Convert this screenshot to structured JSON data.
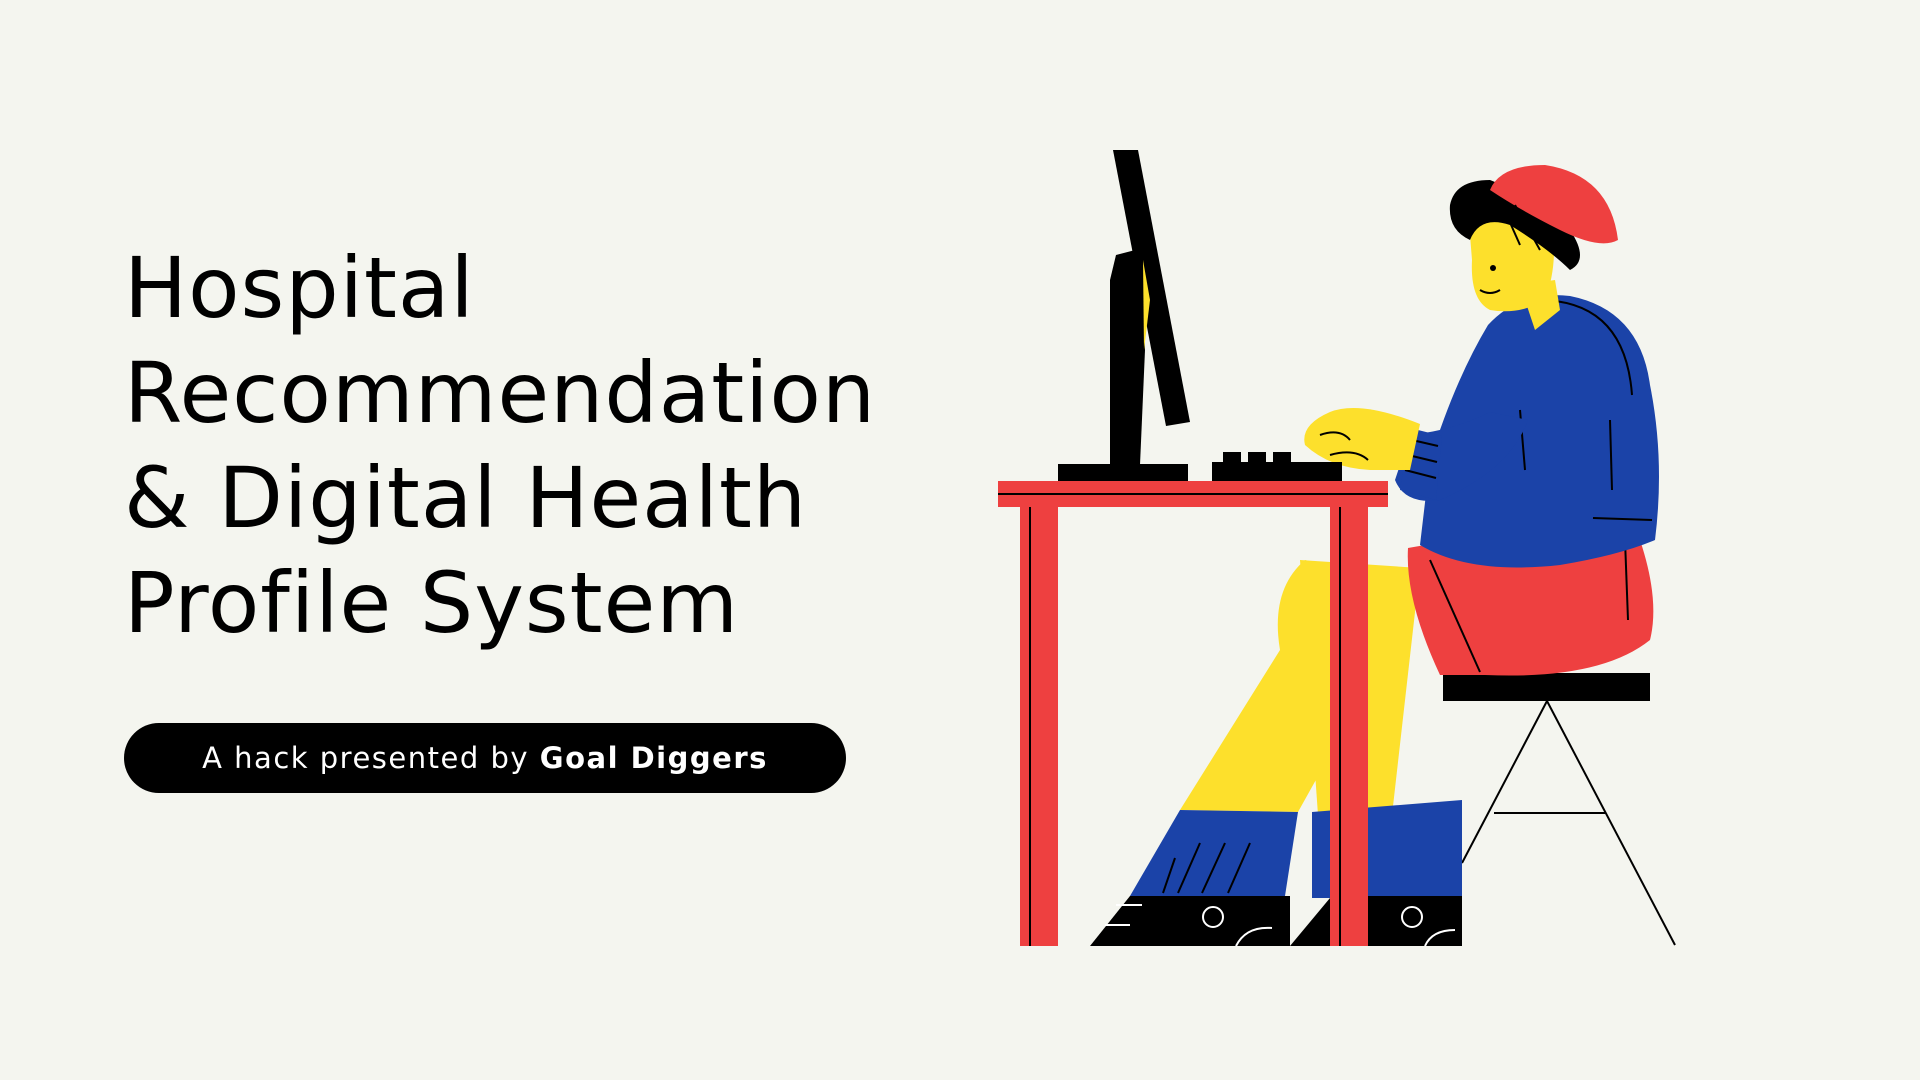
{
  "title": {
    "lines": [
      "Hospital",
      "Recommendation",
      "& Digital Health",
      "Profile System"
    ]
  },
  "subtitle": {
    "prefix": "A hack presented by",
    "team": "Goal Diggers"
  },
  "illustration": {
    "description_icon": "person-typing-at-computer-desk-illustration",
    "colors": {
      "background": "#f4f5ef",
      "red": "#ee4040",
      "yellow": "#fde02c",
      "blue": "#1b43a8",
      "black": "#000000"
    }
  }
}
